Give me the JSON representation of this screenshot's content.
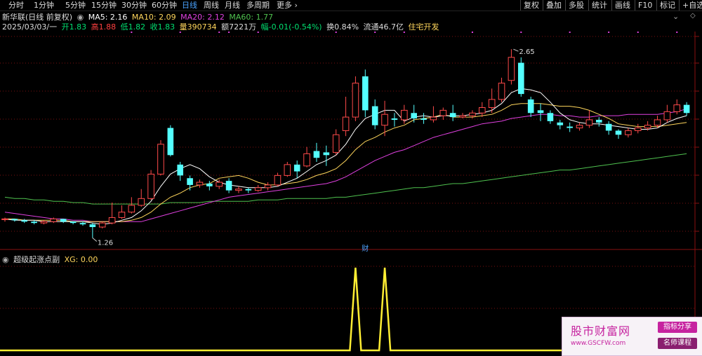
{
  "toolbar": {
    "periods": [
      "分时",
      "1分钟",
      "5分钟",
      "15分钟",
      "30分钟",
      "60分钟",
      "日线",
      "周线",
      "月线",
      "多周期",
      "更多"
    ],
    "active": "日线",
    "right": [
      "复权",
      "叠加",
      "多股",
      "统计",
      "画线",
      "F10",
      "标记",
      "+自选"
    ]
  },
  "header": {
    "title": "新华联(日线 前复权)",
    "ma": [
      {
        "label": "MA5: 2.16",
        "color": "#ffffff"
      },
      {
        "label": "MA10: 2.09",
        "color": "#ffd65c"
      },
      {
        "label": "MA20: 2.12",
        "color": "#e040e0"
      },
      {
        "label": "MA60: 1.77",
        "color": "#4fc24f"
      }
    ],
    "date": "2025/03/03/一",
    "quote": [
      {
        "label": "开",
        "value": "1.83",
        "color": "#00e070"
      },
      {
        "label": "高",
        "value": "1.88",
        "color": "#ff4040"
      },
      {
        "label": "低",
        "value": "1.82",
        "color": "#00e070"
      },
      {
        "label": "收",
        "value": "1.83",
        "color": "#00e070"
      },
      {
        "label": "量",
        "value": "390734",
        "color": "#ffd65c"
      },
      {
        "label": "额",
        "value": "7221万",
        "color": "#dddddd"
      },
      {
        "label": "幅",
        "value": "-0.01(-0.54%)",
        "color": "#00e070"
      },
      {
        "label": "换",
        "value": "0.84%",
        "color": "#dddddd"
      },
      {
        "label": "流通",
        "value": "46.7亿",
        "color": "#dddddd"
      },
      {
        "label": "",
        "value": "住宅开发",
        "color": "#ffd65c"
      }
    ]
  },
  "main_chart": {
    "high_label": "2.65",
    "low_label": "1.26",
    "event_marker": "财",
    "colors": {
      "up": "#ff4a4a",
      "down": "#54ffff",
      "ma5": "#ffffff",
      "ma10": "#ffd65c",
      "ma20": "#e040e0",
      "ma60": "#4fc24f",
      "grid": "#7a1010"
    }
  },
  "chart_data": {
    "type": "candlestick",
    "series_fields": [
      "open",
      "close",
      "high",
      "low"
    ],
    "candles": [
      [
        1.4,
        1.4,
        1.41,
        1.38
      ],
      [
        1.4,
        1.39,
        1.4,
        1.38
      ],
      [
        1.39,
        1.38,
        1.4,
        1.37
      ],
      [
        1.38,
        1.37,
        1.39,
        1.36
      ],
      [
        1.37,
        1.38,
        1.39,
        1.36
      ],
      [
        1.38,
        1.4,
        1.41,
        1.37
      ],
      [
        1.4,
        1.38,
        1.4,
        1.37
      ],
      [
        1.38,
        1.37,
        1.38,
        1.36
      ],
      [
        1.37,
        1.36,
        1.38,
        1.35
      ],
      [
        1.36,
        1.34,
        1.37,
        1.26
      ],
      [
        1.34,
        1.37,
        1.38,
        1.33
      ],
      [
        1.37,
        1.41,
        1.52,
        1.36
      ],
      [
        1.41,
        1.45,
        1.5,
        1.4
      ],
      [
        1.45,
        1.5,
        1.56,
        1.44
      ],
      [
        1.5,
        1.55,
        1.62,
        1.49
      ],
      [
        1.55,
        1.73,
        1.76,
        1.54
      ],
      [
        1.73,
        1.95,
        1.98,
        1.72
      ],
      [
        2.07,
        1.87,
        2.09,
        1.86
      ],
      [
        1.8,
        1.72,
        1.82,
        1.68
      ],
      [
        1.7,
        1.65,
        1.72,
        1.61
      ],
      [
        1.65,
        1.67,
        1.69,
        1.63
      ],
      [
        1.66,
        1.64,
        1.68,
        1.61
      ],
      [
        1.64,
        1.67,
        1.69,
        1.62
      ],
      [
        1.68,
        1.61,
        1.7,
        1.59
      ],
      [
        1.61,
        1.62,
        1.64,
        1.59
      ],
      [
        1.62,
        1.61,
        1.63,
        1.59
      ],
      [
        1.61,
        1.63,
        1.65,
        1.6
      ],
      [
        1.63,
        1.65,
        1.67,
        1.61
      ],
      [
        1.65,
        1.72,
        1.74,
        1.64
      ],
      [
        1.72,
        1.8,
        1.82,
        1.71
      ],
      [
        1.8,
        1.75,
        1.83,
        1.7
      ],
      [
        1.79,
        1.88,
        1.93,
        1.78
      ],
      [
        1.9,
        1.85,
        1.96,
        1.82
      ],
      [
        1.89,
        1.87,
        1.94,
        1.79
      ],
      [
        1.89,
        2.02,
        2.06,
        1.87
      ],
      [
        2.05,
        2.15,
        2.3,
        2.01
      ],
      [
        2.15,
        2.4,
        2.45,
        2.12
      ],
      [
        2.45,
        2.2,
        2.5,
        2.15
      ],
      [
        2.23,
        2.09,
        2.28,
        2.06
      ],
      [
        2.09,
        2.17,
        2.27,
        2.01
      ],
      [
        2.14,
        2.13,
        2.18,
        2.08
      ],
      [
        2.13,
        2.2,
        2.24,
        2.1
      ],
      [
        2.18,
        2.14,
        2.24,
        2.11
      ],
      [
        2.14,
        2.13,
        2.18,
        2.1
      ],
      [
        2.13,
        2.15,
        2.23,
        2.11
      ],
      [
        2.16,
        2.2,
        2.22,
        2.13
      ],
      [
        2.18,
        2.15,
        2.24,
        2.12
      ],
      [
        2.15,
        2.16,
        2.18,
        2.14
      ],
      [
        2.16,
        2.18,
        2.2,
        2.14
      ],
      [
        2.18,
        2.22,
        2.26,
        2.15
      ],
      [
        2.22,
        2.28,
        2.36,
        2.18
      ],
      [
        2.28,
        2.4,
        2.44,
        2.26
      ],
      [
        2.42,
        2.59,
        2.65,
        2.39
      ],
      [
        2.55,
        2.32,
        2.59,
        2.3
      ],
      [
        2.28,
        2.18,
        2.3,
        2.15
      ],
      [
        2.2,
        2.18,
        2.25,
        2.12
      ],
      [
        2.18,
        2.12,
        2.2,
        2.1
      ],
      [
        2.11,
        2.09,
        2.13,
        2.06
      ],
      [
        2.08,
        2.07,
        2.11,
        2.04
      ],
      [
        2.07,
        2.09,
        2.11,
        2.05
      ],
      [
        2.09,
        2.13,
        2.2,
        2.07
      ],
      [
        2.13,
        2.11,
        2.15,
        2.08
      ],
      [
        2.1,
        2.05,
        2.12,
        2.02
      ],
      [
        2.05,
        2.02,
        2.06,
        1.99
      ],
      [
        2.02,
        2.05,
        2.07,
        2.0
      ],
      [
        2.05,
        2.07,
        2.1,
        2.03
      ],
      [
        2.07,
        2.09,
        2.12,
        2.05
      ],
      [
        2.09,
        2.13,
        2.16,
        2.07
      ],
      [
        2.13,
        2.19,
        2.24,
        2.11
      ],
      [
        2.19,
        2.24,
        2.28,
        2.17
      ],
      [
        2.24,
        2.18,
        2.26,
        2.16
      ]
    ],
    "ma5": [
      1.4,
      1.39,
      1.39,
      1.39,
      1.38,
      1.38,
      1.38,
      1.38,
      1.38,
      1.37,
      1.36,
      1.37,
      1.39,
      1.41,
      1.46,
      1.53,
      1.64,
      1.73,
      1.77,
      1.8,
      1.77,
      1.71,
      1.67,
      1.65,
      1.64,
      1.63,
      1.63,
      1.63,
      1.64,
      1.67,
      1.7,
      1.75,
      1.8,
      1.83,
      1.87,
      1.95,
      2.06,
      2.14,
      2.17,
      2.2,
      2.2,
      2.12,
      2.15,
      2.16,
      2.15,
      2.16,
      2.16,
      2.16,
      2.17,
      2.18,
      2.2,
      2.25,
      2.33,
      2.36,
      2.35,
      2.33,
      2.26,
      2.18,
      2.13,
      2.11,
      2.1,
      2.1,
      2.09,
      2.08,
      2.07,
      2.06,
      2.06,
      2.07,
      2.11,
      2.14,
      2.16
    ],
    "ma10": [
      1.4,
      1.4,
      1.39,
      1.39,
      1.39,
      1.39,
      1.39,
      1.38,
      1.38,
      1.38,
      1.38,
      1.38,
      1.38,
      1.39,
      1.41,
      1.45,
      1.51,
      1.56,
      1.59,
      1.63,
      1.65,
      1.66,
      1.7,
      1.71,
      1.72,
      1.7,
      1.67,
      1.65,
      1.65,
      1.66,
      1.67,
      1.69,
      1.72,
      1.74,
      1.77,
      1.83,
      1.91,
      1.97,
      2.0,
      2.04,
      2.07,
      2.09,
      2.13,
      2.14,
      2.15,
      2.17,
      2.15,
      2.15,
      2.15,
      2.16,
      2.17,
      2.2,
      2.24,
      2.25,
      2.25,
      2.25,
      2.24,
      2.23,
      2.23,
      2.22,
      2.2,
      2.17,
      2.14,
      2.1,
      2.09,
      2.08,
      2.08,
      2.08,
      2.09,
      2.1,
      2.11
    ],
    "ma20": [
      1.45,
      1.44,
      1.43,
      1.42,
      1.41,
      1.4,
      1.4,
      1.39,
      1.39,
      1.38,
      1.38,
      1.38,
      1.38,
      1.38,
      1.38,
      1.4,
      1.42,
      1.44,
      1.46,
      1.48,
      1.5,
      1.52,
      1.54,
      1.56,
      1.57,
      1.58,
      1.59,
      1.6,
      1.61,
      1.62,
      1.63,
      1.64,
      1.65,
      1.66,
      1.68,
      1.71,
      1.75,
      1.79,
      1.83,
      1.86,
      1.89,
      1.91,
      1.94,
      1.97,
      2.0,
      2.02,
      2.04,
      2.06,
      2.08,
      2.1,
      2.11,
      2.12,
      2.14,
      2.15,
      2.16,
      2.17,
      2.17,
      2.16,
      2.16,
      2.15,
      2.15,
      2.16,
      2.16,
      2.16,
      2.17,
      2.17,
      2.17,
      2.17,
      2.18,
      2.19,
      2.21
    ],
    "ma60": [
      1.56,
      1.55,
      1.55,
      1.54,
      1.54,
      1.53,
      1.53,
      1.52,
      1.52,
      1.51,
      1.51,
      1.51,
      1.51,
      1.51,
      1.51,
      1.51,
      1.51,
      1.52,
      1.52,
      1.52,
      1.52,
      1.53,
      1.53,
      1.53,
      1.53,
      1.53,
      1.54,
      1.54,
      1.54,
      1.55,
      1.55,
      1.55,
      1.55,
      1.55,
      1.56,
      1.56,
      1.57,
      1.58,
      1.59,
      1.6,
      1.61,
      1.62,
      1.63,
      1.63,
      1.64,
      1.65,
      1.66,
      1.66,
      1.67,
      1.68,
      1.69,
      1.7,
      1.71,
      1.72,
      1.73,
      1.74,
      1.75,
      1.76,
      1.76,
      1.77,
      1.78,
      1.79,
      1.8,
      1.81,
      1.82,
      1.83,
      1.84,
      1.85,
      1.86,
      1.87,
      1.88
    ],
    "xg": [
      0,
      0,
      0,
      0,
      0,
      0,
      0,
      0,
      0,
      0,
      0,
      0,
      0,
      0,
      0,
      0,
      0,
      0,
      0,
      0,
      0,
      0,
      0,
      0,
      0,
      0,
      0,
      0,
      0,
      0,
      0,
      0,
      0,
      0,
      0,
      0,
      1,
      0,
      0,
      1,
      0,
      0,
      0,
      0,
      0,
      0,
      0,
      0,
      0,
      0,
      0,
      0,
      0,
      0,
      0,
      0,
      0,
      0,
      0,
      0,
      0,
      0,
      0,
      0,
      0,
      0,
      0,
      0,
      0,
      0,
      0
    ],
    "ylim": [
      1.18,
      2.78
    ]
  },
  "sub_chart": {
    "title": "超级起涨点副",
    "value_label": "XG: 0.00"
  },
  "watermark": {
    "title": "股市财富网",
    "url": "www.GSCFW.com",
    "tag1": "指标分享",
    "tag2": "名师课程"
  }
}
